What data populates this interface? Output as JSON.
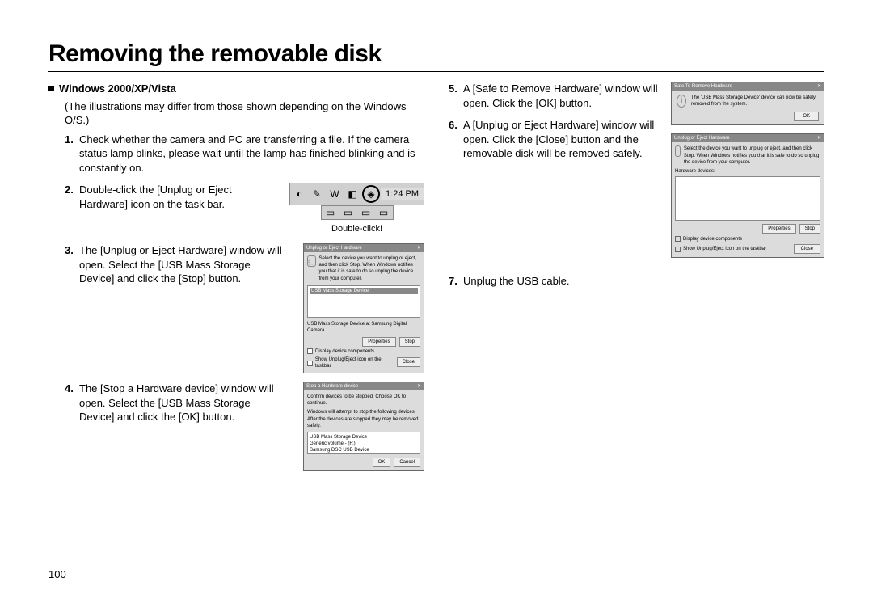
{
  "title": "Removing the removable disk",
  "subhead": "Windows 2000/XP/Vista",
  "intro": "(The illustrations may differ from those shown depending on the Windows O/S.)",
  "steps": {
    "s1": {
      "n": "1.",
      "t": "Check whether the camera and PC are transferring a file. If the camera status lamp blinks, please wait until the lamp has finished blinking and is constantly on."
    },
    "s2": {
      "n": "2.",
      "t": "Double-click the [Unplug or Eject Hardware] icon on the task bar."
    },
    "s3": {
      "n": "3.",
      "t": "The [Unplug or Eject Hardware] window will open. Select the [USB Mass Storage Device] and click the [Stop] button."
    },
    "s4": {
      "n": "4.",
      "t": "The [Stop a Hardware device] window will open. Select the [USB Mass Storage Device] and click the [OK] button."
    },
    "s5": {
      "n": "5.",
      "t": "A [Safe to Remove Hardware] window will open. Click the [OK] button."
    },
    "s6": {
      "n": "6.",
      "t": "A [Unplug or Eject Hardware] window will open. Click the [Close] button and the removable disk will be removed safely."
    },
    "s7": {
      "n": "7.",
      "t": "Unplug the USB cable."
    }
  },
  "taskbar": {
    "time": "1:24 PM",
    "caption": "Double-click!"
  },
  "dialog3": {
    "title": "Unplug or Eject Hardware",
    "msg": "Select the device you want to unplug or eject, and then click Stop. When Windows notifies you that it is safe to do so unplug the device from your computer.",
    "listitem": "USB Mass Storage Device",
    "sub": "USB Mass Storage Device at Samsung Digital Camera",
    "btn1": "Properties",
    "btn2": "Stop",
    "chk1": "Display device components",
    "chk2": "Show Unplug/Eject icon on the taskbar",
    "close": "Close"
  },
  "dialog4": {
    "title": "Stop a Hardware device",
    "msg": "Confirm devices to be stopped. Choose OK to continue.",
    "msg2": "Windows will attempt to stop the following devices. After the devices are stopped they may be removed safely.",
    "li1": "USB Mass Storage Device",
    "li2": "Generic volume - (F:)",
    "li3": "Samsung DSC USB Device",
    "ok": "OK",
    "cancel": "Cancel"
  },
  "dialog5": {
    "title": "Safe To Remove Hardware",
    "msg": "The 'USB Mass Storage Device' device can now be safely removed from the system.",
    "ok": "OK"
  },
  "dialog6": {
    "title": "Unplug or Eject Hardware",
    "msg": "Select the device you want to unplug or eject, and then click Stop. When Windows notifies you that it is safe to do so unplug the device from your computer.",
    "hwlabel": "Hardware devices:",
    "btn1": "Properties",
    "btn2": "Stop",
    "chk1": "Display device components",
    "chk2": "Show Unplug/Eject icon on the taskbar",
    "close": "Close"
  },
  "pagenum": "100"
}
